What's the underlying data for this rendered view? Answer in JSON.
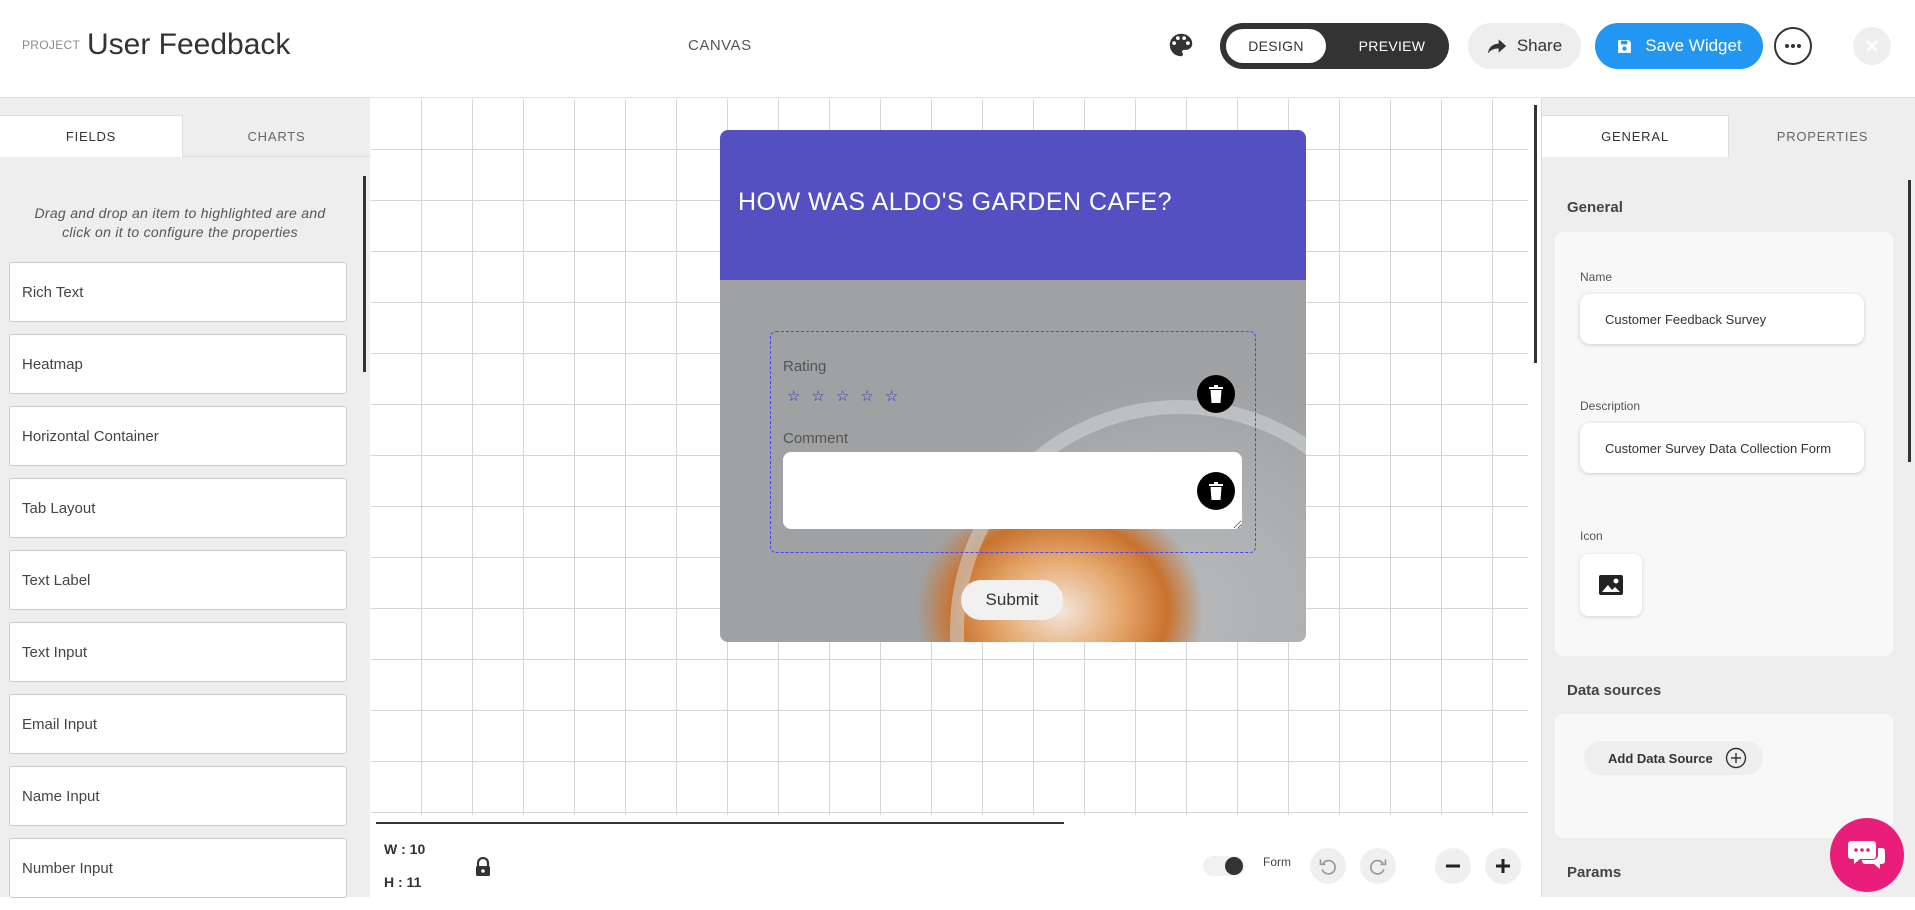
{
  "header": {
    "project_label": "PROJECT",
    "project_title": "User Feedback",
    "canvas_label": "CANVAS",
    "mode_design": "DESIGN",
    "mode_preview": "PREVIEW",
    "share_label": "Share",
    "save_label": "Save Widget"
  },
  "left_panel": {
    "tabs": [
      "FIELDS",
      "CHARTS"
    ],
    "hint": "Drag and drop an item to highlighted are and click on it to configure the properties",
    "items": [
      "Rich Text",
      "Heatmap",
      "Horizontal Container",
      "Tab Layout",
      "Text Label",
      "Text Input",
      "Email Input",
      "Name Input",
      "Number Input"
    ]
  },
  "widget": {
    "title": "HOW WAS ALDO'S GARDEN CAFE?",
    "rating_label": "Rating",
    "stars": [
      "☆",
      "☆",
      "☆",
      "☆",
      "☆"
    ],
    "comment_label": "Comment",
    "comment_value": "",
    "submit_label": "Submit",
    "header_color": "#5550c2"
  },
  "canvas_footer": {
    "width_label": "W : 10",
    "height_label": "H : 11",
    "form_label": "Form"
  },
  "right_panel": {
    "tabs": [
      "GENERAL",
      "PROPERTIES"
    ],
    "general_title": "General",
    "name_caption": "Name",
    "name_value": "Customer Feedback Survey",
    "description_caption": "Description",
    "description_value": "Customer Survey Data Collection Form",
    "icon_caption": "Icon",
    "data_sources_title": "Data sources",
    "add_data_source_label": "Add Data Source",
    "params_title": "Params"
  },
  "icons": {
    "palette": "palette-icon",
    "share": "share-arrow-icon",
    "save": "floppy-disk-icon",
    "more": "ellipsis-icon",
    "close": "close-icon",
    "delete": "trash-icon",
    "lock": "lock-icon",
    "undo": "undo-icon",
    "redo": "redo-icon",
    "zoom_out": "minus-icon",
    "zoom_in": "plus-icon",
    "image": "image-icon",
    "add": "plus-circle-icon",
    "chat": "chat-icon"
  },
  "colors": {
    "accent": "#2196f3",
    "chat": "#e91e7b",
    "dark": "#333333"
  }
}
